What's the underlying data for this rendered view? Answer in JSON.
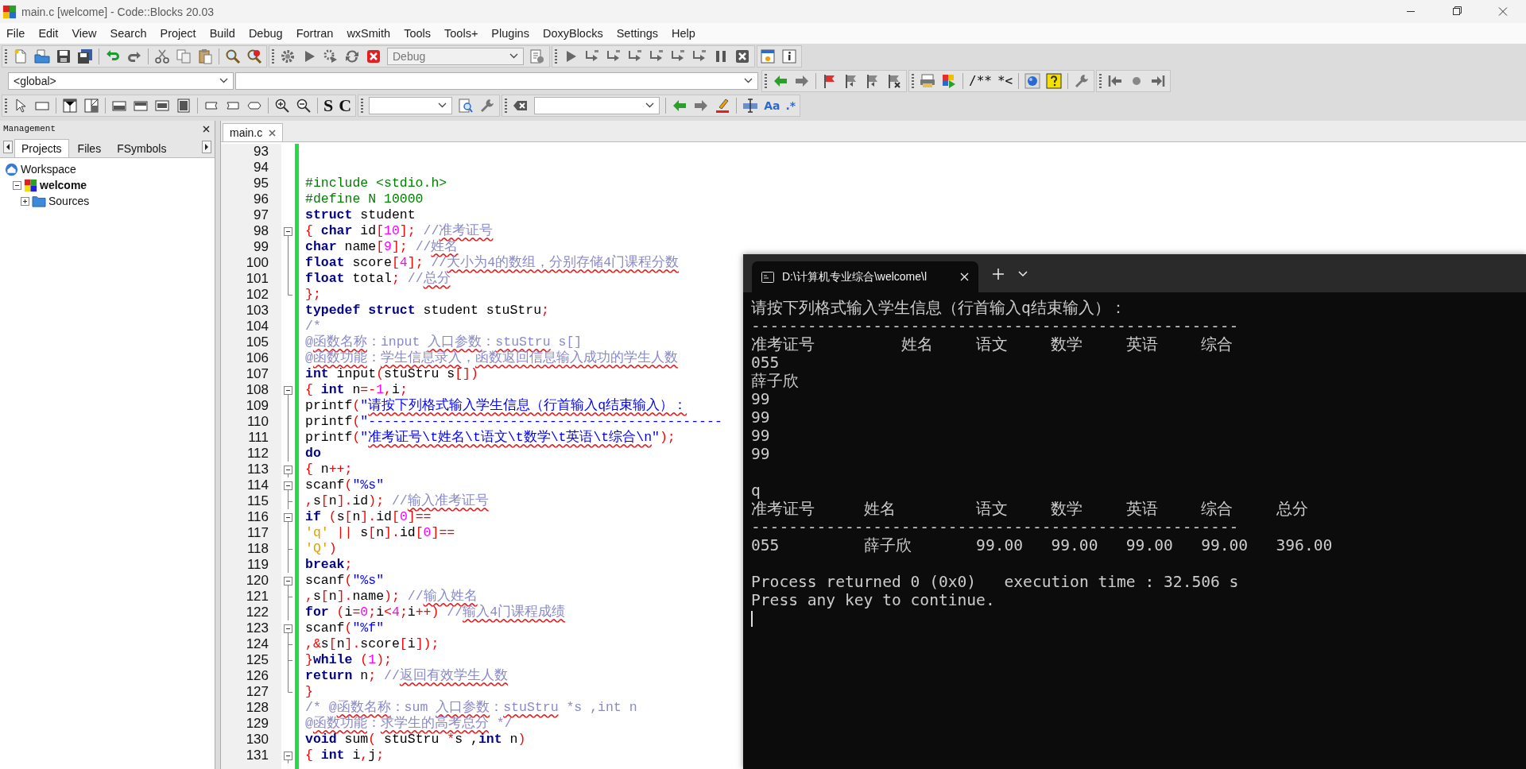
{
  "window": {
    "title": "main.c [welcome] - Code::Blocks 20.03"
  },
  "menu": [
    "File",
    "Edit",
    "View",
    "Search",
    "Project",
    "Build",
    "Debug",
    "Fortran",
    "wxSmith",
    "Tools",
    "Tools+",
    "Plugins",
    "DoxyBlocks",
    "Settings",
    "Help"
  ],
  "toolbar": {
    "build_target": "Debug",
    "scope": "<global>",
    "text_tools": [
      "S",
      "C"
    ],
    "doxy_tools": [
      "/**",
      "*<"
    ],
    "search_tools": [
      "Aa",
      ".*"
    ]
  },
  "management": {
    "title": "Management",
    "tabs": [
      {
        "label": "Projects",
        "selected": true
      },
      {
        "label": "Files",
        "selected": false
      },
      {
        "label": "FSymbols",
        "selected": false
      }
    ],
    "tree": [
      {
        "label": "Workspace",
        "kind": "workspace",
        "active": false,
        "children": [
          {
            "label": "welcome",
            "kind": "project",
            "active": true,
            "expanded": true,
            "children": [
              {
                "label": "Sources",
                "kind": "folder",
                "active": false,
                "expanded": false
              }
            ]
          }
        ]
      }
    ]
  },
  "editor": {
    "tabs": [
      {
        "label": "main.c",
        "selected": true
      }
    ],
    "lines": [
      {
        "number": "93",
        "kind": "plain"
      },
      {
        "number": "94",
        "kind": "plain"
      },
      {
        "number": "95",
        "kind": "plain",
        "tokens": [
          {
            "kind": "pp",
            "text": "#include <stdio.h>"
          }
        ]
      },
      {
        "number": "96",
        "kind": "plain",
        "tokens": [
          {
            "kind": "pp",
            "text": "#define N 10000"
          }
        ]
      },
      {
        "number": "97",
        "kind": "plain",
        "tokens": [
          {
            "kind": "kw",
            "text": "struct"
          },
          {
            "kind": "id",
            "text": " student"
          }
        ]
      },
      {
        "number": "98",
        "kind": "fold_start",
        "tokens": [
          {
            "kind": "op",
            "text": "{ "
          },
          {
            "kind": "kw",
            "text": "char"
          },
          {
            "kind": "id",
            "text": " id"
          },
          {
            "kind": "op",
            "text": "["
          },
          {
            "kind": "num",
            "text": "10"
          },
          {
            "kind": "op",
            "text": "];"
          },
          {
            "kind": "cm",
            "text": " //"
          },
          {
            "kind": "cm",
            "text": "准考证号",
            "spell": true
          }
        ]
      },
      {
        "number": "99",
        "kind": "fold_line",
        "tokens": [
          {
            "kind": "kw",
            "text": "char"
          },
          {
            "kind": "id",
            "text": " name"
          },
          {
            "kind": "op",
            "text": "["
          },
          {
            "kind": "num",
            "text": "9"
          },
          {
            "kind": "op",
            "text": "];"
          },
          {
            "kind": "cm",
            "text": " //"
          },
          {
            "kind": "cm",
            "text": "姓名",
            "spell": true
          }
        ]
      },
      {
        "number": "100",
        "kind": "fold_line",
        "tokens": [
          {
            "kind": "kw",
            "text": "float"
          },
          {
            "kind": "id",
            "text": " score"
          },
          {
            "kind": "op",
            "text": "["
          },
          {
            "kind": "num",
            "text": "4"
          },
          {
            "kind": "op",
            "text": "];"
          },
          {
            "kind": "cm",
            "text": " //"
          },
          {
            "kind": "cm",
            "text": "大小为4的数组，分别存储4门课程分数",
            "spell": true
          }
        ]
      },
      {
        "number": "101",
        "kind": "fold_line",
        "tokens": [
          {
            "kind": "kw",
            "text": "float"
          },
          {
            "kind": "id",
            "text": " total"
          },
          {
            "kind": "op",
            "text": ";"
          },
          {
            "kind": "cm",
            "text": " //"
          },
          {
            "kind": "cm",
            "text": "总分",
            "spell": true
          }
        ]
      },
      {
        "number": "102",
        "kind": "fold_end",
        "tokens": [
          {
            "kind": "op",
            "text": "};"
          }
        ]
      },
      {
        "number": "103",
        "kind": "plain",
        "tokens": [
          {
            "kind": "kw",
            "text": "typedef"
          },
          {
            "kind": "kw",
            "text": " struct"
          },
          {
            "kind": "id",
            "text": " student stuStru"
          },
          {
            "kind": "op",
            "text": ";"
          }
        ]
      },
      {
        "number": "104",
        "kind": "plain",
        "tokens": [
          {
            "kind": "cm",
            "text": "/*"
          }
        ]
      },
      {
        "number": "105",
        "kind": "plain",
        "tokens": [
          {
            "kind": "cm",
            "text": "@"
          },
          {
            "kind": "cm",
            "text": "函数名称",
            "spell": true
          },
          {
            "kind": "cm",
            "text": "：input "
          },
          {
            "kind": "cm",
            "text": "入口参数",
            "spell": true
          },
          {
            "kind": "cm",
            "text": "："
          },
          {
            "kind": "cm",
            "text": "stuStru",
            "spell": true
          },
          {
            "kind": "cm",
            "text": " s[]"
          }
        ]
      },
      {
        "number": "106",
        "kind": "plain",
        "tokens": [
          {
            "kind": "cm",
            "text": "@"
          },
          {
            "kind": "cm",
            "text": "函数功能",
            "spell": true
          },
          {
            "kind": "cm",
            "text": "："
          },
          {
            "kind": "cm",
            "text": "学生信息录入",
            "spell": true
          },
          {
            "kind": "cm",
            "text": "，"
          },
          {
            "kind": "cm",
            "text": "函数返回信息输入成功的学生人数",
            "spell": true
          }
        ]
      },
      {
        "number": "107",
        "kind": "plain",
        "tokens": [
          {
            "kind": "kw",
            "text": "int"
          },
          {
            "kind": "id",
            "text": " input"
          },
          {
            "kind": "op",
            "text": "("
          },
          {
            "kind": "id",
            "text": "stuStru s"
          },
          {
            "kind": "op",
            "text": "[])"
          }
        ]
      },
      {
        "number": "108",
        "kind": "fold_start",
        "tokens": [
          {
            "kind": "op",
            "text": "{ "
          },
          {
            "kind": "kw",
            "text": "int"
          },
          {
            "kind": "id",
            "text": " n"
          },
          {
            "kind": "op",
            "text": "=-"
          },
          {
            "kind": "num",
            "text": "1"
          },
          {
            "kind": "op",
            "text": ","
          },
          {
            "kind": "id",
            "text": "i"
          },
          {
            "kind": "op",
            "text": ";"
          }
        ]
      },
      {
        "number": "109",
        "kind": "fold_line",
        "tokens": [
          {
            "kind": "id",
            "text": "printf"
          },
          {
            "kind": "op",
            "text": "("
          },
          {
            "kind": "str",
            "text": "\""
          },
          {
            "kind": "str",
            "text": "请按下列格式输入学生信息（行首输入q结束输入）：",
            "spell": true
          }
        ]
      },
      {
        "number": "110",
        "kind": "fold_line",
        "tokens": [
          {
            "kind": "id",
            "text": "printf"
          },
          {
            "kind": "op",
            "text": "("
          },
          {
            "kind": "str",
            "text": "\"---------------------------------------------"
          }
        ]
      },
      {
        "number": "111",
        "kind": "fold_line",
        "tokens": [
          {
            "kind": "id",
            "text": "printf"
          },
          {
            "kind": "op",
            "text": "("
          },
          {
            "kind": "str",
            "text": "\""
          },
          {
            "kind": "str",
            "text": "准考证号\\t姓名\\t语文\\t数学\\t英语\\t综合\\n",
            "spell": true
          },
          {
            "kind": "str",
            "text": "\""
          },
          {
            "kind": "op",
            "text": ");"
          }
        ]
      },
      {
        "number": "112",
        "kind": "fold_line",
        "tokens": [
          {
            "kind": "kw",
            "text": "do"
          }
        ]
      },
      {
        "number": "113",
        "kind": "fold_start",
        "tokens": [
          {
            "kind": "op",
            "text": "{"
          },
          {
            "kind": "id",
            "text": " n"
          },
          {
            "kind": "op",
            "text": "++;"
          }
        ]
      },
      {
        "number": "114",
        "kind": "fold_start",
        "tokens": [
          {
            "kind": "id",
            "text": "scanf"
          },
          {
            "kind": "op",
            "text": "("
          },
          {
            "kind": "str",
            "text": "\"%s\""
          }
        ]
      },
      {
        "number": "115",
        "kind": "fold_branch",
        "tokens": [
          {
            "kind": "op",
            "text": ","
          },
          {
            "kind": "id",
            "text": "s"
          },
          {
            "kind": "op",
            "text": "["
          },
          {
            "kind": "id",
            "text": "n"
          },
          {
            "kind": "op",
            "text": "]."
          },
          {
            "kind": "id",
            "text": "id"
          },
          {
            "kind": "op",
            "text": ");"
          },
          {
            "kind": "cm",
            "text": " //"
          },
          {
            "kind": "cm",
            "text": "输入准考证号",
            "spell": true
          }
        ]
      },
      {
        "number": "116",
        "kind": "fold_start",
        "tokens": [
          {
            "kind": "kw",
            "text": "if"
          },
          {
            "kind": "op",
            "text": " ("
          },
          {
            "kind": "id",
            "text": "s"
          },
          {
            "kind": "op",
            "text": "["
          },
          {
            "kind": "id",
            "text": "n"
          },
          {
            "kind": "op",
            "text": "]."
          },
          {
            "kind": "id",
            "text": "id"
          },
          {
            "kind": "op",
            "text": "["
          },
          {
            "kind": "num",
            "text": "0"
          },
          {
            "kind": "op",
            "text": "]=="
          }
        ]
      },
      {
        "number": "117",
        "kind": "fold_line",
        "tokens": [
          {
            "kind": "chr",
            "text": "'q'"
          },
          {
            "kind": "op",
            "text": " ||"
          },
          {
            "kind": "id",
            "text": " s"
          },
          {
            "kind": "op",
            "text": "["
          },
          {
            "kind": "id",
            "text": "n"
          },
          {
            "kind": "op",
            "text": "]."
          },
          {
            "kind": "id",
            "text": "id"
          },
          {
            "kind": "op",
            "text": "["
          },
          {
            "kind": "num",
            "text": "0"
          },
          {
            "kind": "op",
            "text": "]=="
          }
        ]
      },
      {
        "number": "118",
        "kind": "fold_branch",
        "tokens": [
          {
            "kind": "chr",
            "text": "'Q'"
          },
          {
            "kind": "op",
            "text": ")"
          }
        ]
      },
      {
        "number": "119",
        "kind": "fold_line",
        "tokens": [
          {
            "kind": "kw",
            "text": "break"
          },
          {
            "kind": "op",
            "text": ";"
          }
        ]
      },
      {
        "number": "120",
        "kind": "fold_start",
        "tokens": [
          {
            "kind": "id",
            "text": "scanf"
          },
          {
            "kind": "op",
            "text": "("
          },
          {
            "kind": "str",
            "text": "\"%s\""
          }
        ]
      },
      {
        "number": "121",
        "kind": "fold_branch",
        "tokens": [
          {
            "kind": "op",
            "text": ","
          },
          {
            "kind": "id",
            "text": "s"
          },
          {
            "kind": "op",
            "text": "["
          },
          {
            "kind": "id",
            "text": "n"
          },
          {
            "kind": "op",
            "text": "]."
          },
          {
            "kind": "id",
            "text": "name"
          },
          {
            "kind": "op",
            "text": ");"
          },
          {
            "kind": "cm",
            "text": " //"
          },
          {
            "kind": "cm",
            "text": "输入姓名",
            "spell": true
          }
        ]
      },
      {
        "number": "122",
        "kind": "fold_line",
        "tokens": [
          {
            "kind": "kw",
            "text": "for"
          },
          {
            "kind": "op",
            "text": " ("
          },
          {
            "kind": "id",
            "text": "i"
          },
          {
            "kind": "op",
            "text": "="
          },
          {
            "kind": "num",
            "text": "0"
          },
          {
            "kind": "op",
            "text": ";"
          },
          {
            "kind": "id",
            "text": "i"
          },
          {
            "kind": "op",
            "text": "<"
          },
          {
            "kind": "num",
            "text": "4"
          },
          {
            "kind": "op",
            "text": ";"
          },
          {
            "kind": "id",
            "text": "i"
          },
          {
            "kind": "op",
            "text": "++)"
          },
          {
            "kind": "cm",
            "text": " //"
          },
          {
            "kind": "cm",
            "text": "输入4门课程成绩",
            "spell": true
          }
        ]
      },
      {
        "number": "123",
        "kind": "fold_start",
        "tokens": [
          {
            "kind": "id",
            "text": "scanf"
          },
          {
            "kind": "op",
            "text": "("
          },
          {
            "kind": "str",
            "text": "\"%f\""
          }
        ]
      },
      {
        "number": "124",
        "kind": "fold_branch",
        "tokens": [
          {
            "kind": "op",
            "text": ",&"
          },
          {
            "kind": "id",
            "text": "s"
          },
          {
            "kind": "op",
            "text": "["
          },
          {
            "kind": "id",
            "text": "n"
          },
          {
            "kind": "op",
            "text": "]."
          },
          {
            "kind": "id",
            "text": "score"
          },
          {
            "kind": "op",
            "text": "["
          },
          {
            "kind": "id",
            "text": "i"
          },
          {
            "kind": "op",
            "text": "]);"
          }
        ]
      },
      {
        "number": "125",
        "kind": "fold_branch",
        "tokens": [
          {
            "kind": "op",
            "text": "}"
          },
          {
            "kind": "kw",
            "text": "while"
          },
          {
            "kind": "op",
            "text": " ("
          },
          {
            "kind": "num",
            "text": "1"
          },
          {
            "kind": "op",
            "text": ");"
          }
        ]
      },
      {
        "number": "126",
        "kind": "fold_line",
        "tokens": [
          {
            "kind": "kw",
            "text": "return"
          },
          {
            "kind": "id",
            "text": " n"
          },
          {
            "kind": "op",
            "text": ";"
          },
          {
            "kind": "cm",
            "text": " //"
          },
          {
            "kind": "cm",
            "text": "返回有效学生人数",
            "spell": true
          }
        ]
      },
      {
        "number": "127",
        "kind": "fold_end",
        "tokens": [
          {
            "kind": "op",
            "text": "}"
          }
        ]
      },
      {
        "number": "128",
        "kind": "plain",
        "tokens": [
          {
            "kind": "cm",
            "text": "/* @"
          },
          {
            "kind": "cm",
            "text": "函数名称",
            "spell": true
          },
          {
            "kind": "cm",
            "text": "：sum "
          },
          {
            "kind": "cm",
            "text": "入口参数",
            "spell": true
          },
          {
            "kind": "cm",
            "text": "："
          },
          {
            "kind": "cm",
            "text": "stuStru",
            "spell": true
          },
          {
            "kind": "cm",
            "text": " *s ,int n"
          }
        ]
      },
      {
        "number": "129",
        "kind": "plain",
        "tokens": [
          {
            "kind": "cm",
            "text": "@"
          },
          {
            "kind": "cm",
            "text": "函数功能",
            "spell": true
          },
          {
            "kind": "cm",
            "text": "："
          },
          {
            "kind": "cm",
            "text": "求学生的高考总分",
            "spell": true
          },
          {
            "kind": "cm",
            "text": " */"
          }
        ]
      },
      {
        "number": "130",
        "kind": "plain",
        "tokens": [
          {
            "kind": "kw",
            "text": "void"
          },
          {
            "kind": "id",
            "text": " sum"
          },
          {
            "kind": "op",
            "text": "("
          },
          {
            "kind": "id",
            "text": " stuStru "
          },
          {
            "kind": "op",
            "text": "*"
          },
          {
            "kind": "id",
            "text": "s ,"
          },
          {
            "kind": "kw",
            "text": "int"
          },
          {
            "kind": "id",
            "text": " n"
          },
          {
            "kind": "op",
            "text": ")"
          }
        ]
      },
      {
        "number": "131",
        "kind": "fold_start",
        "tokens": [
          {
            "kind": "op",
            "text": "{ "
          },
          {
            "kind": "kw",
            "text": "int"
          },
          {
            "kind": "id",
            "text": " i"
          },
          {
            "kind": "op",
            "text": ","
          },
          {
            "kind": "id",
            "text": "j"
          },
          {
            "kind": "op",
            "text": ";"
          }
        ]
      }
    ]
  },
  "terminal": {
    "tab_title": "D:\\计算机专业综合\\welcome\\l",
    "lines": [
      {
        "kind": "text",
        "cells": [
          "请按下列格式输入学生信息（行首输入q结束输入）："
        ]
      },
      {
        "kind": "text",
        "cells": [
          "----------------------------------------------------"
        ]
      },
      {
        "kind": "input_header",
        "cells": [
          "准考证号",
          "姓名",
          "语文",
          "数学",
          "英语",
          "综合"
        ]
      },
      {
        "kind": "text",
        "cells": [
          "055"
        ]
      },
      {
        "kind": "text",
        "cells": [
          "薛子欣"
        ]
      },
      {
        "kind": "text",
        "cells": [
          "99"
        ]
      },
      {
        "kind": "text",
        "cells": [
          "99"
        ]
      },
      {
        "kind": "text",
        "cells": [
          "99"
        ]
      },
      {
        "kind": "text",
        "cells": [
          "99"
        ]
      },
      {
        "kind": "blank"
      },
      {
        "kind": "text",
        "cells": [
          "q"
        ]
      },
      {
        "kind": "result_header",
        "cells": [
          "准考证号",
          "姓名",
          "语文",
          "数学",
          "英语",
          "综合",
          "总分"
        ]
      },
      {
        "kind": "text",
        "cells": [
          "----------------------------------------------------"
        ]
      },
      {
        "kind": "result_row",
        "cells": [
          "055",
          "薛子欣",
          "99.00",
          "99.00",
          "99.00",
          "99.00",
          "396.00"
        ]
      },
      {
        "kind": "blank"
      },
      {
        "kind": "text",
        "cells": [
          "Process returned 0 (0x0)   execution time : 32.506 s"
        ]
      },
      {
        "kind": "text",
        "cells": [
          "Press any key to continue."
        ]
      },
      {
        "kind": "cursor"
      }
    ]
  }
}
